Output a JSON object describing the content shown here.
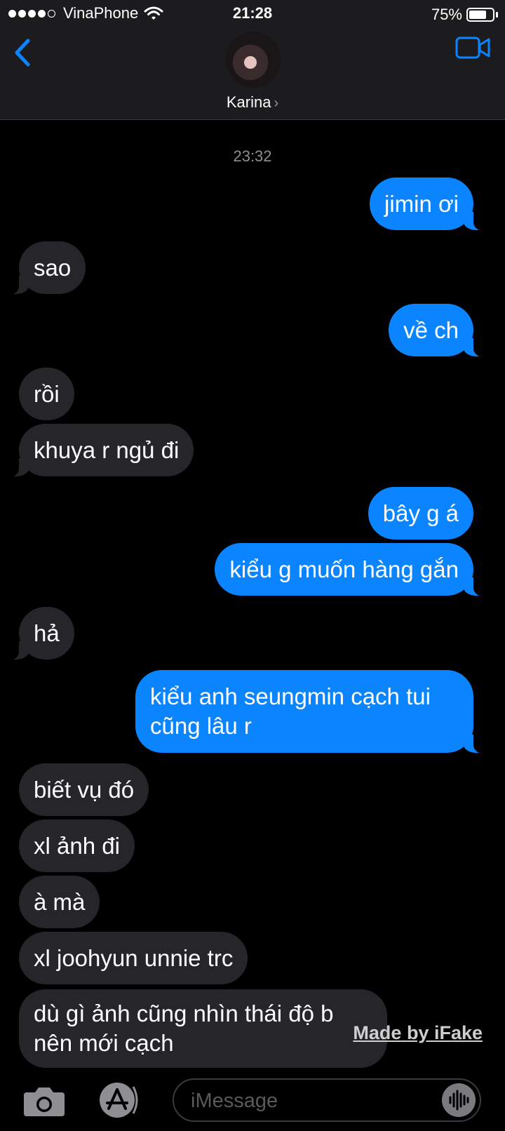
{
  "status_bar": {
    "carrier": "VinaPhone",
    "time": "21:28",
    "battery_text": "75%",
    "battery_level": 0.75,
    "signal_bars_filled": 4,
    "signal_bars_total": 5,
    "icons": [
      "signal-dots-icon",
      "wifi-icon",
      "battery-icon"
    ]
  },
  "header": {
    "contact_name": "Karina",
    "chevron": "›",
    "icons": [
      "back-chevron-icon",
      "video-camera-icon"
    ],
    "accent_color": "#0a84ff"
  },
  "conversation": {
    "timestamp": "23:32",
    "messages": [
      {
        "from": "me",
        "text": "jimin ơi"
      },
      {
        "from": "them",
        "text": "sao"
      },
      {
        "from": "me",
        "text": "về ch"
      },
      {
        "from": "them",
        "text": "rồi"
      },
      {
        "from": "them",
        "text": "khuya r ngủ đi"
      },
      {
        "from": "me",
        "text": "bây g á"
      },
      {
        "from": "me",
        "text": "kiểu g muốn hàng gắn"
      },
      {
        "from": "them",
        "text": "hả"
      },
      {
        "from": "me",
        "text": "kiểu anh seungmin cạch tui cũng lâu r"
      },
      {
        "from": "them",
        "text": "biết vụ đó"
      },
      {
        "from": "them",
        "text": "xl ảnh đi"
      },
      {
        "from": "them",
        "text": "à mà"
      },
      {
        "from": "them",
        "text": "xl joohyun unnie trc"
      },
      {
        "from": "them",
        "text": "dù gì ảnh cũng nhìn thái độ b nên mới cạch"
      }
    ]
  },
  "watermark": "Made by iFake",
  "input_bar": {
    "placeholder": "iMessage",
    "icons": [
      "camera-icon",
      "app-store-icon",
      "audio-waveform-icon"
    ]
  },
  "colors": {
    "sent_bubble": "#0a84ff",
    "received_bubble": "#26252a",
    "background": "#000000"
  }
}
